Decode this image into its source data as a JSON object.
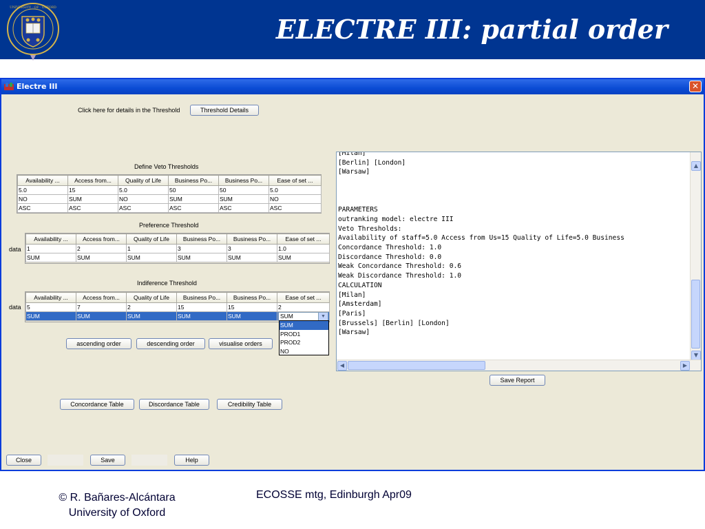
{
  "slide": {
    "title": "ELECTRE III: partial order",
    "footer_author": "© R. Bañares-Alcántara",
    "footer_affiliation": "University of Oxford",
    "footer_event": "ECOSSE mtg, Edinburgh Apr09",
    "crest_text": "UNIVERSITY · OF · OXFORD"
  },
  "window": {
    "title": "Electre III",
    "close_glyph": "✕",
    "threshold_hint": "Click here for details in the Threshold",
    "threshold_button": "Threshold Details"
  },
  "veto": {
    "title": "Define Veto Thresholds",
    "headers": [
      "Availability ...",
      "Access from...",
      "Quality of Life",
      "Business Po...",
      "Business Po...",
      "Ease of set ..."
    ],
    "rows": [
      [
        "5.0",
        "15",
        "5.0",
        "50",
        "50",
        "5.0"
      ],
      [
        "NO",
        "SUM",
        "NO",
        "SUM",
        "SUM",
        "NO"
      ],
      [
        "ASC",
        "ASC",
        "ASC",
        "ASC",
        "ASC",
        "ASC"
      ]
    ]
  },
  "preference": {
    "title": "Preference Threshold",
    "row_label": "data",
    "headers": [
      "Availability ...",
      "Access from...",
      "Quality of Life",
      "Business Po...",
      "Business Po...",
      "Ease of set ..."
    ],
    "rows": [
      [
        "1",
        "2",
        "1",
        "3",
        "3",
        "1.0"
      ],
      [
        "SUM",
        "SUM",
        "SUM",
        "SUM",
        "SUM",
        "SUM"
      ]
    ]
  },
  "indifference": {
    "title": "Indiference Threshold",
    "row_label": "data",
    "headers": [
      "Availability ...",
      "Access from...",
      "Quality of Life",
      "Business Po...",
      "Business Po...",
      "Ease of set ..."
    ],
    "rows": [
      [
        "5",
        "7",
        "2",
        "15",
        "15",
        "2"
      ],
      [
        "SUM",
        "SUM",
        "SUM",
        "SUM",
        "SUM",
        "SUM"
      ]
    ],
    "combo_value": "SUM",
    "combo_options": [
      "SUM",
      "PROD1",
      "PROD2",
      "NO"
    ]
  },
  "order_buttons": {
    "ascending": "ascending order",
    "descending": "descending order",
    "visualise": "visualise orders"
  },
  "table_buttons": {
    "concordance": "Concordance Table",
    "discordance": "Discordance Table",
    "credibility": "Credibility Table"
  },
  "bottom_buttons": {
    "close": "Close",
    "save": "Save",
    "help": "Help"
  },
  "report": {
    "lines": [
      "[Milan]",
      "[Berlin] [London]",
      "[Warsaw]",
      "",
      "",
      "",
      "PARAMETERS",
      "outranking model: electre III",
      "Veto Thresholds:",
      "Availability of staff=5.0 Access from Us=15 Quality of Life=5.0 Business",
      "Concordance Threshold: 1.0",
      "Discordance Threshold: 0.0",
      "Weak Concordance Threshold: 0.6",
      "Weak Discordance Threshold: 1.0",
      "CALCULATION",
      "[Milan]",
      "[Amsterdam]",
      "[Paris]",
      "[Brussels] [Berlin] [London]",
      "[Warsaw]"
    ],
    "save_button": "Save Report",
    "scroll_up": "▲",
    "scroll_down": "▼",
    "scroll_left": "◀",
    "scroll_right": "▶"
  },
  "colors": {
    "banner": "#003591",
    "window_border": "#0a3ddb",
    "selection": "#316ac5"
  }
}
